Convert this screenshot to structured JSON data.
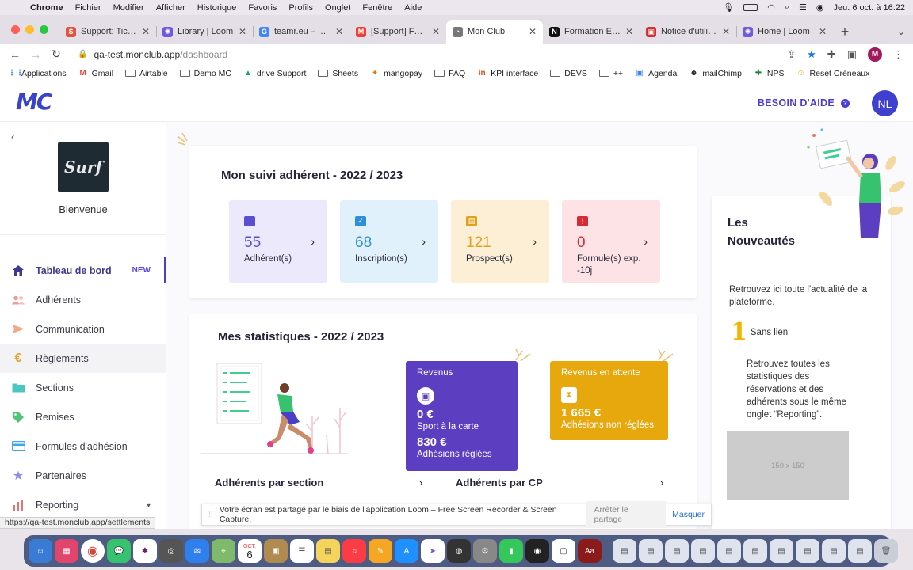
{
  "menubar": {
    "app": "Chrome",
    "items": [
      "Fichier",
      "Modifier",
      "Afficher",
      "Historique",
      "Favoris",
      "Profils",
      "Onglet",
      "Fenêtre",
      "Aide"
    ],
    "clock": "Jeu. 6 oct. à 16:22"
  },
  "tabs": [
    {
      "label": "Support: Ticket",
      "color": "#e2543b",
      "glyph": "S"
    },
    {
      "label": "Library | Loom",
      "color": "#6f5bd9",
      "glyph": "✺"
    },
    {
      "label": "teamr.eu – Age",
      "color": "#4285f4",
      "glyph": "G"
    },
    {
      "label": "[Support] Fwd:",
      "color": "#ea4335",
      "glyph": "M"
    },
    {
      "label": "Mon Club",
      "color": "#777",
      "glyph": "◔"
    },
    {
      "label": "Formation Expo",
      "color": "#111",
      "glyph": "N"
    },
    {
      "label": "Notice d'utilisat",
      "color": "#d32f2f",
      "glyph": "▣"
    },
    {
      "label": "Home | Loom",
      "color": "#6f5bd9",
      "glyph": "✺"
    }
  ],
  "address": {
    "host": "qa-test.monclub.app",
    "path": "/dashboard"
  },
  "bookmarks": [
    {
      "label": "Applications",
      "icon": "apps-icon"
    },
    {
      "label": "Gmail",
      "icon": "gmail-icon"
    },
    {
      "label": "Airtable",
      "icon": "folder-icon"
    },
    {
      "label": "Demo MC",
      "icon": "folder-icon"
    },
    {
      "label": "drive Support",
      "icon": "drive-icon"
    },
    {
      "label": "Sheets",
      "icon": "folder-icon"
    },
    {
      "label": "mangopay",
      "icon": "mangopay-icon"
    },
    {
      "label": "FAQ",
      "icon": "folder-icon"
    },
    {
      "label": "KPI interface",
      "icon": "linkedin-icon"
    },
    {
      "label": "DEVS",
      "icon": "folder-icon"
    },
    {
      "label": "++",
      "icon": "folder-icon"
    },
    {
      "label": "Agenda",
      "icon": "calendar-icon"
    },
    {
      "label": "mailChimp",
      "icon": "mailchimp-icon"
    },
    {
      "label": "NPS",
      "icon": "plus-icon"
    },
    {
      "label": "Reset Créneaux",
      "icon": "smiley-icon"
    }
  ],
  "header": {
    "logo": "MC",
    "help": "BESOIN D'AIDE",
    "user_initials": "NL",
    "help_icon": "?"
  },
  "sidebar": {
    "club_logo_text": "Surf",
    "welcome": "Bienvenue",
    "items": [
      {
        "label": "Tableau de bord",
        "badge": "NEW",
        "icon": "home-icon"
      },
      {
        "label": "Adhérents",
        "icon": "users-icon"
      },
      {
        "label": "Communication",
        "icon": "send-icon"
      },
      {
        "label": "Règlements",
        "icon": "euro-icon"
      },
      {
        "label": "Sections",
        "icon": "folder-icon"
      },
      {
        "label": "Remises",
        "icon": "tag-icon"
      },
      {
        "label": "Formules d'adhésion",
        "icon": "card-icon"
      },
      {
        "label": "Partenaires",
        "icon": "star-icon"
      },
      {
        "label": "Reporting",
        "icon": "chart-icon"
      }
    ]
  },
  "suivi": {
    "title": "Mon suivi adhérent - 2022 / 2023",
    "tiles": [
      {
        "value": "55",
        "label": "Adhérent(s)",
        "bg": "#ebe9fb",
        "accent": "#5a4fcf",
        "icon": "users-icon"
      },
      {
        "value": "68",
        "label": "Inscription(s)",
        "bg": "#e1f1fb",
        "accent": "#2f8fd8",
        "icon": "check-icon"
      },
      {
        "value": "121",
        "label": "Prospect(s)",
        "bg": "#fcefd6",
        "accent": "#e0a21e",
        "icon": "id-card-icon"
      },
      {
        "value": "0",
        "label": "Formule(s) exp. -10j",
        "bg": "#fde3e6",
        "accent": "#d62b36",
        "icon": "warning-icon"
      }
    ]
  },
  "stats": {
    "title": "Mes statistiques - 2022 / 2023",
    "revenus": {
      "label": "Revenus",
      "amount1": "0 €",
      "sub1": "Sport à la carte",
      "amount2": "830 €",
      "sub2": "Adhésions réglées"
    },
    "attente": {
      "label": "Revenus en attente",
      "amount": "1 665 €",
      "sub": "Adhésions non réglées"
    },
    "link_section": "Adhérents par section",
    "link_cp": "Adhérents par CP"
  },
  "news": {
    "title": "Les Nouveautés",
    "intro": "Retrouvez ici toute l'actualité de la plateforme.",
    "number": "1",
    "item_title": "Sans lien",
    "item_text": "Retrouvez toutes les statistiques des réservations et des adhérents sous le même onglet “Reporting”.",
    "placeholder": "150 x 150"
  },
  "sharebar": {
    "text": "Votre écran est partagé par le biais de l'application Loom – Free Screen Recorder & Screen Capture.",
    "stop": "Arrêter le partage",
    "hide": "Masquer"
  },
  "status_url": "https://qa-test.monclub.app/settlements",
  "dock_calendar": {
    "month": "OCT.",
    "day": "6"
  },
  "colors": {
    "primary": "#4b3fc7",
    "revenus": "#5b3fc0",
    "attente": "#e7a80d"
  }
}
